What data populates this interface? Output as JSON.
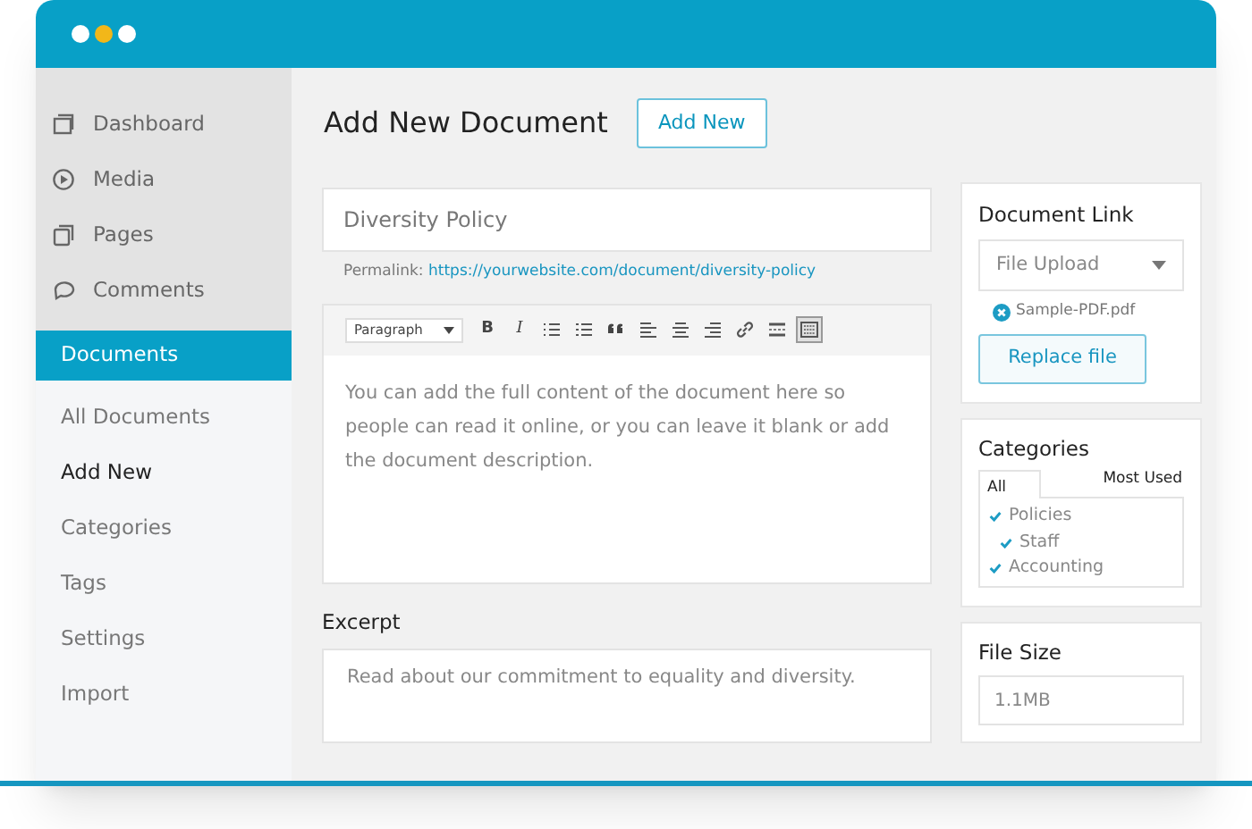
{
  "sidebar": {
    "menu": [
      {
        "label": "Dashboard",
        "selected": false
      },
      {
        "label": "Media",
        "selected": false
      },
      {
        "label": "Pages",
        "selected": false
      },
      {
        "label": "Comments",
        "selected": false
      },
      {
        "label": "Documents",
        "selected": true
      }
    ],
    "submenu": [
      {
        "label": "All Documents",
        "selected": false
      },
      {
        "label": "Add New",
        "selected": true
      },
      {
        "label": "Categories",
        "selected": false
      },
      {
        "label": "Tags",
        "selected": false
      },
      {
        "label": "Settings",
        "selected": false
      },
      {
        "label": "Import",
        "selected": false
      }
    ]
  },
  "page": {
    "title": "Add New Document",
    "add_button": "Add New"
  },
  "title_field": {
    "value": "Diversity Policy"
  },
  "permalink": {
    "label": "Permalink:",
    "url": "https://yourwebsite.com/document/diversity-policy"
  },
  "editor": {
    "format": "Paragraph",
    "toolbar": [
      {
        "kind": "text",
        "label": "B",
        "selected": false
      },
      {
        "kind": "text",
        "label": "I",
        "selected": false
      },
      {
        "kind": "icon",
        "selected": false
      },
      {
        "kind": "icon",
        "selected": false
      },
      {
        "kind": "icon",
        "selected": false
      },
      {
        "kind": "icon",
        "selected": false
      },
      {
        "kind": "icon",
        "selected": false
      },
      {
        "kind": "icon",
        "selected": false
      },
      {
        "kind": "icon",
        "selected": false
      },
      {
        "kind": "icon",
        "selected": false
      },
      {
        "kind": "icon",
        "selected": true
      }
    ],
    "content": "You can add the full content of the document here so people can read it online, or you can leave it blank or add the document description."
  },
  "excerpt": {
    "label": "Excerpt",
    "value": "Read about our commitment to equality and diversity."
  },
  "document_link": {
    "title": "Document Link",
    "select": "File Upload",
    "file": "Sample-PDF.pdf",
    "button": "Replace file"
  },
  "categories": {
    "title": "Categories",
    "tabs": [
      {
        "label": "All",
        "selected": true
      },
      {
        "label": "Most Used",
        "selected": false
      }
    ],
    "items": [
      {
        "label": "Policies",
        "checked": true,
        "children": [
          {
            "label": "Staff",
            "checked": true
          }
        ]
      },
      {
        "label": "Accounting",
        "checked": true
      }
    ]
  },
  "file_size": {
    "title": "File Size",
    "value": "1.1MB"
  }
}
